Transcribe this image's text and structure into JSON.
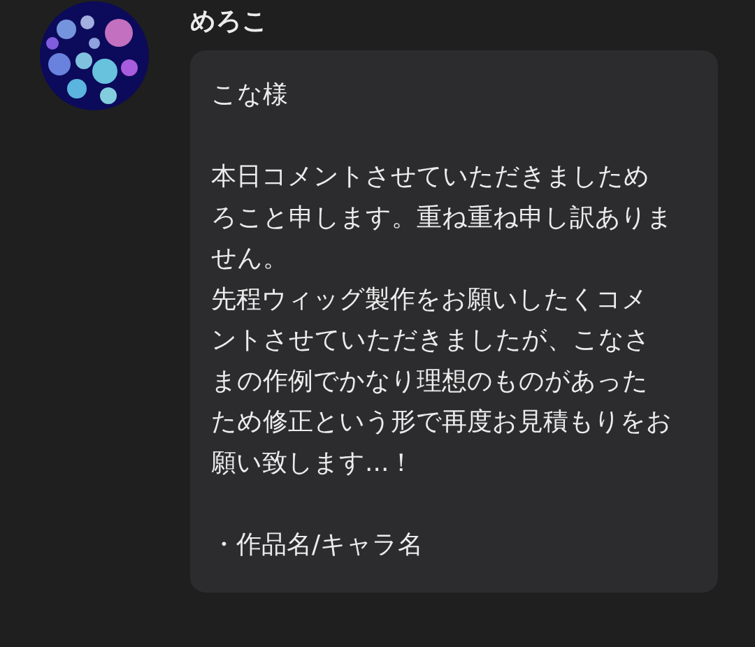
{
  "message": {
    "author": "めろこ",
    "avatar": {
      "kind": "picture"
    },
    "blocks": [
      [
        "こな様"
      ],
      [
        "本日コメントさせていただきましためろこと申します。重ね重ね申し訳ありません。",
        "先程ウィッグ製作をお願いしたくコメントさせていただきましたが、こなさまの作例でかなり理想のものがあったため修正という形で再度お見積もりをお願い致します...！"
      ],
      [
        "・作品名/キャラ名"
      ]
    ]
  }
}
